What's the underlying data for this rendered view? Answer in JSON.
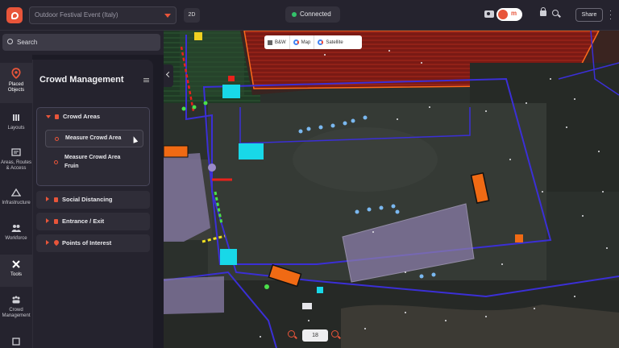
{
  "header": {
    "project": "Outdoor Festival Event (Italy)",
    "view_mode": "2D",
    "status": "Connected",
    "toggle_text": "m",
    "share_label": "Share"
  },
  "sidebar": {
    "search_placeholder": "Search",
    "rail": [
      {
        "label": "Placed\nObjects",
        "l1": "Placed",
        "l2": "Objects",
        "icon": "map-pin-icon"
      },
      {
        "label": "Layouts",
        "icon": "layers-icon"
      },
      {
        "label": "Areas, Routes & Access",
        "l1": "Areas, Routes",
        "l2": "& Access",
        "icon": "route-icon"
      },
      {
        "label": "Infrastructure",
        "icon": "tent-icon"
      },
      {
        "label": "Workforce",
        "icon": "people-icon"
      },
      {
        "label": "Tools",
        "icon": "tools-icon"
      },
      {
        "label": "Crowd Management",
        "l1": "Crowd",
        "l2": "Management",
        "icon": "crowd-icon"
      }
    ]
  },
  "panel": {
    "title": "Crowd Management",
    "groups": [
      {
        "label": "Crowd Areas",
        "expanded": true,
        "items": [
          {
            "label": "Measure Crowd Area",
            "selected": true
          },
          {
            "label_l1": "Measure Crowd Area",
            "label_l2": "Fruin"
          }
        ]
      },
      {
        "label": "Social Distancing"
      },
      {
        "label": "Entrance / Exit"
      },
      {
        "label": "Points of Interest"
      }
    ]
  },
  "map": {
    "layers": [
      "B&W",
      "Map",
      "Satellite"
    ],
    "zoom": "18",
    "colors": {
      "accent": "#e8553a",
      "boundary": "#3b2fd6",
      "zone": "#8a7ca8",
      "cyan": "#18d8e8",
      "orange": "#f06a14"
    }
  }
}
